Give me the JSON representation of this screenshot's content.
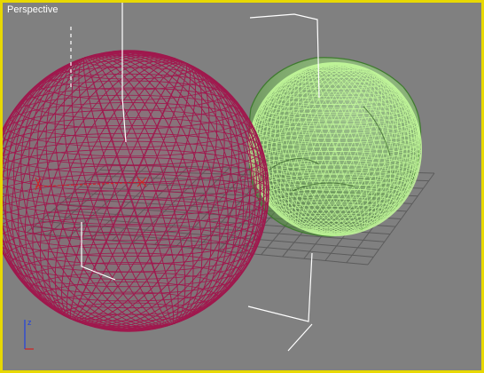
{
  "viewport": {
    "label": "Perspective",
    "border_color": "#e8d800",
    "background_color": "#808080"
  },
  "scene": {
    "objects": [
      {
        "name": "large-sphere",
        "type": "geosphere",
        "display": "wireframe",
        "color": "#a0194e"
      },
      {
        "name": "small-sphere",
        "type": "noisy-sphere",
        "display": "wireframe",
        "color": "#8ee06a"
      }
    ],
    "grid_color": "#5c5c5c",
    "selection_brackets_color": "#ffffff",
    "axis_tripod": [
      "x",
      "y",
      "z"
    ]
  },
  "colors": {
    "axis_x": "#d22020",
    "axis_z": "#2040e0"
  }
}
